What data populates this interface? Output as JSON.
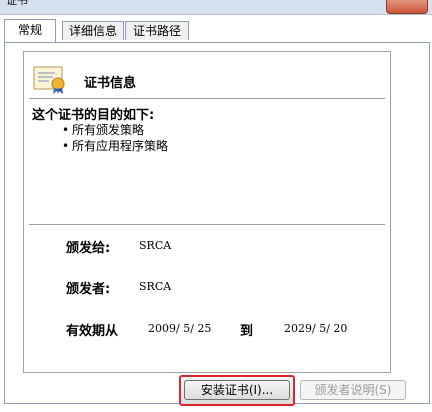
{
  "window": {
    "title": "证书"
  },
  "tabs": [
    {
      "label": "常规",
      "active": true
    },
    {
      "label": "详细信息",
      "active": false
    },
    {
      "label": "证书路径",
      "active": false
    }
  ],
  "cert": {
    "heading": "证书信息",
    "purpose_heading": "这个证书的目的如下:",
    "purposes": [
      "所有颁发策略",
      "所有应用程序策略"
    ],
    "issued_to_label": "颁发给:",
    "issued_to_value": "SRCA",
    "issued_by_label": "颁发者:",
    "issued_by_value": "SRCA",
    "valid_from_label": "有效期从",
    "valid_from_value": "2009/ 5/ 25",
    "valid_to_label": "到",
    "valid_to_value": "2029/ 5/ 20"
  },
  "buttons": {
    "install": "安装证书(I)...",
    "issuer_statement": "颁发者说明(S)"
  },
  "colors": {
    "focus_highlight": "#d8262c",
    "tab_border": "#8e9fb5"
  }
}
